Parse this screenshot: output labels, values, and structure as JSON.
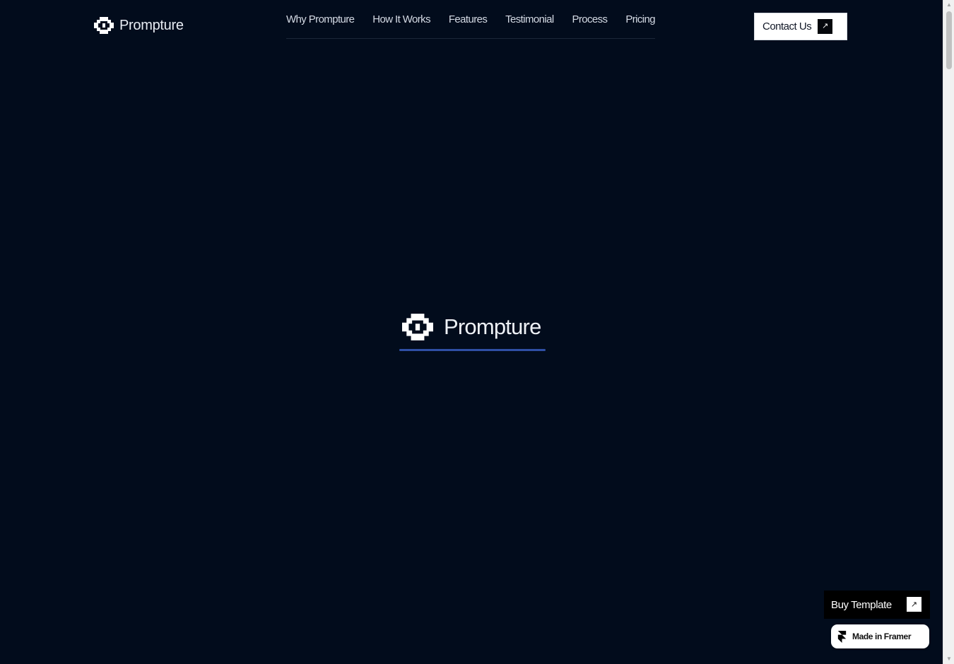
{
  "brand": {
    "name": "Prompture",
    "logo_icon": "prompture-logo-icon"
  },
  "nav": {
    "items": [
      {
        "label": "Why Prompture"
      },
      {
        "label": "How It Works"
      },
      {
        "label": "Features"
      },
      {
        "label": "Testimonial"
      },
      {
        "label": "Process"
      },
      {
        "label": "Pricing"
      }
    ]
  },
  "header": {
    "contact_label": "Contact Us",
    "contact_icon": "arrow-up-right-icon"
  },
  "loader": {
    "brand_name": "Prompture",
    "progress_fraction": 1.0
  },
  "floating": {
    "buy_template_label": "Buy Template",
    "buy_template_icon": "arrow-up-right-icon",
    "made_in_framer_label": "Made in Framer",
    "framer_icon": "framer-icon"
  },
  "colors": {
    "background": "#020c1c",
    "accent": "#2f4fa5",
    "text": "#e9edf4"
  }
}
